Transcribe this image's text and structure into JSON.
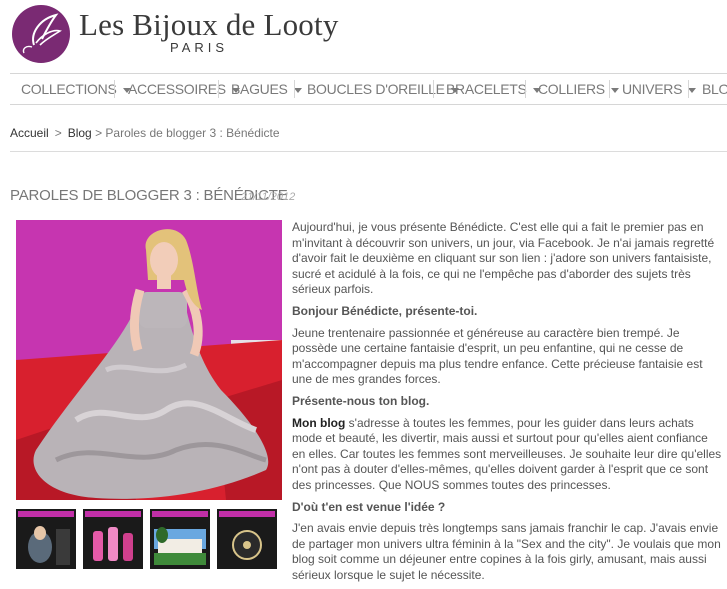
{
  "header": {
    "brand": "Les Bijoux de Looty",
    "brand_sub": "PARIS"
  },
  "nav": {
    "items": [
      {
        "label": "COLLECTIONS"
      },
      {
        "label": "ACCESSOIRES"
      },
      {
        "label": "BAGUES"
      },
      {
        "label": "BOUCLES D'OREILLE"
      },
      {
        "label": "BRACELETS"
      },
      {
        "label": "COLLIERS"
      },
      {
        "label": "UNIVERS"
      },
      {
        "label": "BLOG"
      }
    ]
  },
  "breadcrumb": {
    "home": "Accueil",
    "sep": ">",
    "blog": "Blog",
    "current": "> Paroles de blogger 3 : Bénédicte"
  },
  "post": {
    "title": "PAROLES DE BLOGGER 3 : BÉNÉDICTE",
    "date": "21/11/2012",
    "p1": "Aujourd'hui, je vous présente Bénédicte. C'est elle qui a fait le premier pas en m'invitant à découvrir son univers, un jour, via Facebook. Je n'ai jamais regretté d'avoir fait le deuxième en cliquant sur son lien : j'adore son univers fantaisiste, sucré et acidulé à la fois, ce qui ne l'empêche pas d'aborder des sujets très sérieux parfois.",
    "q1": "Bonjour Bénédicte, présente-toi.",
    "p2": "Jeune trentenaire passionnée et généreuse au caractère bien trempé. Je possède une certaine fantaisie d'esprit, un peu enfantine, qui ne cesse de m'accompagner depuis ma plus tendre enfance. Cette précieuse fantaisie est une de mes grandes forces.",
    "q2": "Présente-nous ton blog.",
    "p3_bold": "Mon blog",
    "p3": " s'adresse à toutes les femmes, pour les guider dans leurs achats mode et beauté, les divertir, mais aussi et surtout pour qu'elles aient confiance en elles. Car toutes les femmes sont merveilleuses. Je souhaite leur dire qu'elles n'ont pas à douter d'elles-mêmes, qu'elles doivent garder à l'esprit que ce sont des princesses. Que NOUS sommes toutes des princesses.",
    "q3": "D'où t'en est venue l'idée ?",
    "p4": "J'en avais envie depuis très longtemps sans jamais franchir le cap. J'avais envie de partager mon univers ultra féminin à la \"Sex and the city\". Je voulais que mon blog soit comme un déjeuner entre copines à la fois girly, amusant, mais aussi sérieux lorsque le sujet le nécessite."
  },
  "colors": {
    "brand_purple": "#7a2a73",
    "photo_magenta": "#c12fa8",
    "photo_red": "#d8202e"
  }
}
